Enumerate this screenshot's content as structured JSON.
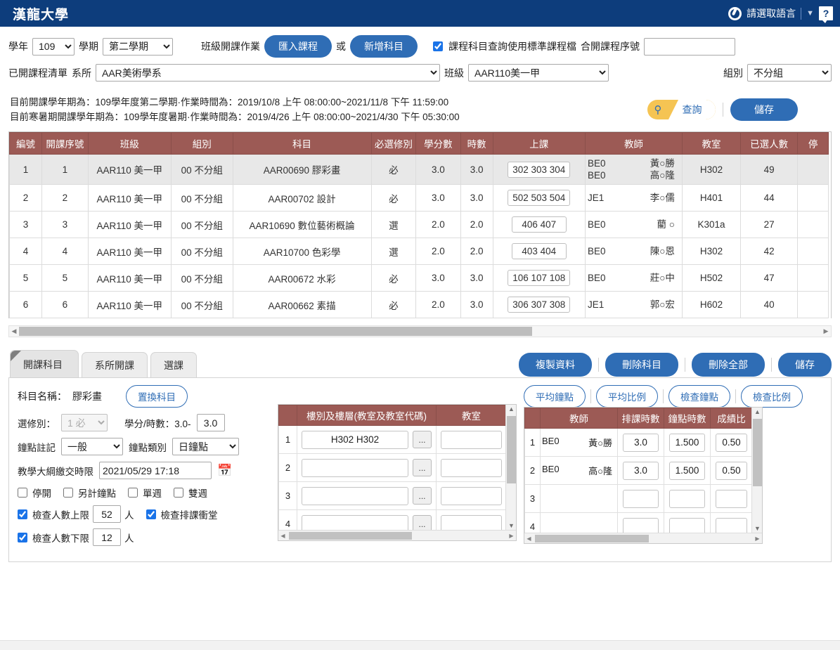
{
  "header": {
    "brand": "漢龍大學",
    "language_label": "請選取語言",
    "caret": "▼",
    "help": "?"
  },
  "filters": {
    "year_label": "學年",
    "year_value": "109",
    "term_label": "學期",
    "term_value": "第二學期",
    "class_op_label": "班級開課作業",
    "import_button": "匯入課程",
    "or_text": "或",
    "add_button": "新增科目",
    "std_course_checkbox_label": "課程科目查詢使用標準課程檔",
    "std_course_checked": true,
    "joint_seq_label": "合開課程序號",
    "joint_seq_value": "",
    "opened_list_label": "已開課程清單",
    "dept_label": "系所",
    "dept_value": "AAR美術學系",
    "class_label": "班級",
    "class_value": "AAR110美一甲",
    "group_label": "組別",
    "group_value": "不分組"
  },
  "notice": {
    "line1": "目前開課學年期為：109學年度第二學期·作業時間為：2019/10/8 上午 08:00:00~2021/11/8 下午 11:59:00",
    "line2": "目前寒暑期開課學年期為：109學年度暑期·作業時間為：2019/4/26 上午 08:00:00~2021/4/30 下午 05:30:00",
    "query_button": "查詢",
    "save_button": "儲存"
  },
  "main_table": {
    "headers": [
      "編號",
      "開課序號",
      "班級",
      "組別",
      "科目",
      "必選修別",
      "學分數",
      "時數",
      "上課",
      "教師",
      "教室",
      "已選人數",
      "停"
    ],
    "rows": [
      {
        "no": "1",
        "seq": "1",
        "class": "AAR110 美一甲",
        "group": "00 不分組",
        "subject": "AAR00690 膠彩畫",
        "required": "必",
        "credits": "3.0",
        "hours": "3.0",
        "time": "302 303 304",
        "teachers": [
          {
            "code": "BE0",
            "name": "黃○勝"
          },
          {
            "code": "BE0",
            "name": "高○隆"
          }
        ],
        "room": "H302",
        "enrolled": "49",
        "selected": true
      },
      {
        "no": "2",
        "seq": "2",
        "class": "AAR110 美一甲",
        "group": "00 不分組",
        "subject": "AAR00702 設計",
        "required": "必",
        "credits": "3.0",
        "hours": "3.0",
        "time": "502 503 504",
        "teachers": [
          {
            "code": "JE1",
            "name": "李○儒"
          }
        ],
        "room": "H401",
        "enrolled": "44",
        "selected": false
      },
      {
        "no": "3",
        "seq": "3",
        "class": "AAR110 美一甲",
        "group": "00 不分組",
        "subject": "AAR10690 數位藝術概論",
        "required": "選",
        "credits": "2.0",
        "hours": "2.0",
        "time": "406 407",
        "teachers": [
          {
            "code": "BE0",
            "name": "藺 ○"
          }
        ],
        "room": "K301a",
        "enrolled": "27",
        "selected": false
      },
      {
        "no": "4",
        "seq": "4",
        "class": "AAR110 美一甲",
        "group": "00 不分組",
        "subject": "AAR10700 色彩學",
        "required": "選",
        "credits": "2.0",
        "hours": "2.0",
        "time": "403 404",
        "teachers": [
          {
            "code": "BE0",
            "name": "陳○恩"
          }
        ],
        "room": "H302",
        "enrolled": "42",
        "selected": false
      },
      {
        "no": "5",
        "seq": "5",
        "class": "AAR110 美一甲",
        "group": "00 不分組",
        "subject": "AAR00672 水彩",
        "required": "必",
        "credits": "3.0",
        "hours": "3.0",
        "time": "106 107 108",
        "teachers": [
          {
            "code": "BE0",
            "name": "莊○中"
          }
        ],
        "room": "H502",
        "enrolled": "47",
        "selected": false
      },
      {
        "no": "6",
        "seq": "6",
        "class": "AAR110 美一甲",
        "group": "00 不分組",
        "subject": "AAR00662 素描",
        "required": "必",
        "credits": "2.0",
        "hours": "3.0",
        "time": "306 307 308",
        "teachers": [
          {
            "code": "JE1",
            "name": "郭○宏"
          }
        ],
        "room": "H602",
        "enrolled": "40",
        "selected": false
      }
    ]
  },
  "panel": {
    "tabs": [
      {
        "label": "開課科目",
        "active": true
      },
      {
        "label": "系所開課",
        "active": false
      },
      {
        "label": "選課",
        "active": false
      }
    ],
    "header_buttons": [
      "複製資料",
      "刪除科目",
      "刪除全部",
      "儲存"
    ],
    "subject_name_label": "科目名稱：",
    "subject_name_value": "膠彩畫",
    "replace_button": "置換科目",
    "tool_buttons": [
      "平均鐘點",
      "平均比例",
      "檢查鐘點",
      "檢查比例"
    ],
    "form": {
      "elective_label": "選修別：",
      "elective_value": "1 必",
      "credit_hour_label": "學分/時數：3.0-",
      "hour_value": "3.0",
      "hour_note_label": "鐘點註記",
      "hour_note_value": "一般",
      "hour_type_label": "鐘點類別",
      "hour_type_value": "日鐘點",
      "syllabus_label": "教學大綱繳交時限",
      "syllabus_value": "2021/05/29 17:18",
      "cb_suspend": "停開",
      "cb_extra_hours": "另計鐘點",
      "cb_odd_week": "單週",
      "cb_even_week": "雙週",
      "cb_check_max": "檢查人數上限",
      "max_value": "52",
      "unit_person": "人",
      "cb_check_conflict": "檢查排課衝堂",
      "cb_check_min": "檢查人數下限",
      "min_value": "12",
      "checked_max": true,
      "checked_min": true,
      "checked_conflict": true,
      "checked_suspend": false,
      "checked_extra": false,
      "checked_odd": false,
      "checked_even": false
    },
    "room_table": {
      "headers": [
        "",
        "樓別及樓層(教室及教室代碼)",
        "教室"
      ],
      "rows": [
        {
          "idx": "1",
          "building": "H302 H302",
          "room": ""
        },
        {
          "idx": "2",
          "building": "",
          "room": ""
        },
        {
          "idx": "3",
          "building": "",
          "room": ""
        },
        {
          "idx": "4",
          "building": "",
          "room": ""
        }
      ],
      "dots": "..."
    },
    "teacher_table": {
      "headers": [
        "",
        "教師",
        "排課時數",
        "鐘點時數",
        "成績比"
      ],
      "rows": [
        {
          "idx": "1",
          "code": "BE0",
          "name": "黃○勝",
          "sched_hours": "3.0",
          "pay_hours": "1.500",
          "grade_ratio": "0.50"
        },
        {
          "idx": "2",
          "code": "BE0",
          "name": "高○隆",
          "sched_hours": "3.0",
          "pay_hours": "1.500",
          "grade_ratio": "0.50"
        },
        {
          "idx": "3",
          "code": "",
          "name": "",
          "sched_hours": "",
          "pay_hours": "",
          "grade_ratio": ""
        },
        {
          "idx": "4",
          "code": "",
          "name": "",
          "sched_hours": "",
          "pay_hours": "",
          "grade_ratio": ""
        }
      ]
    }
  },
  "colors": {
    "navy": "#0d3d7c",
    "accent_blue": "#2f6db5",
    "table_header": "#9c5a55",
    "query_yellow": "#f5c453"
  }
}
